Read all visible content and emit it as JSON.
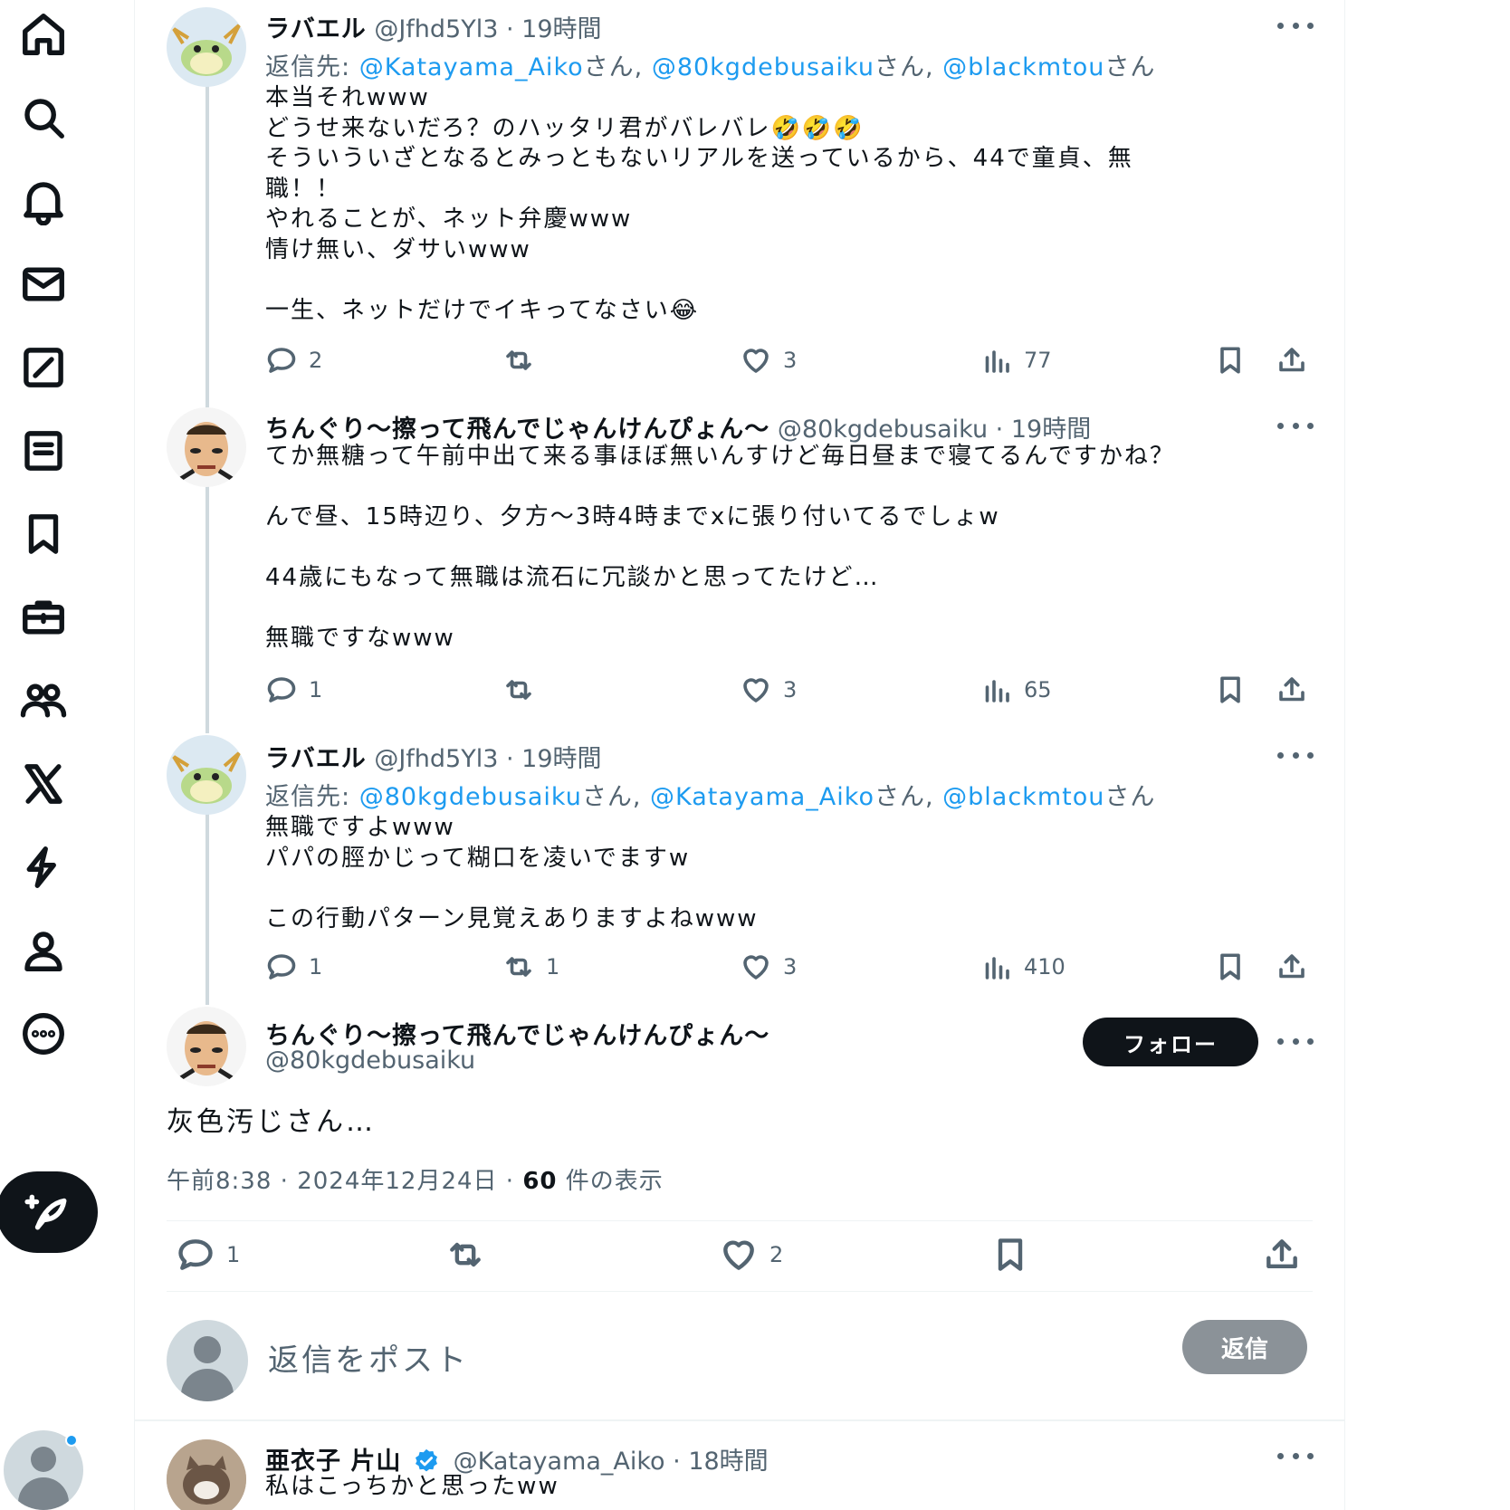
{
  "nav": {
    "icons": [
      "home-icon",
      "search-icon",
      "bell-icon",
      "mail-icon",
      "grok-icon",
      "lists-icon",
      "bookmark-icon",
      "jobs-icon",
      "communities-icon",
      "x-logo-icon",
      "verified-orgs-icon",
      "profile-icon",
      "more-icon"
    ]
  },
  "posts": [
    {
      "name": "ラバエル",
      "handle": "@Jfhd5Yl3",
      "time": "19時間",
      "reply_label": "返信先: ",
      "mentions": [
        "@Katayama_Aiko",
        "@80kgdebusaiku",
        "@blackmtou"
      ],
      "san": "さん",
      "comma": ", ",
      "body": "本当それwww\nどうせ来ないだろ？のハッタリ君がバレバレ🤣🤣🤣\nそういういざとなるとみっともないリアルを送っているから、44で童貞、無\n職！！\nやれることが、ネット弁慶www\n情け無い、ダサいwww\n\n一生、ネットだけでイキってなさい😂",
      "replies": "2",
      "reposts": "",
      "likes": "3",
      "views": "77"
    },
    {
      "name": "ちんぐり〜擦って飛んでじゃんけんぴょん〜",
      "handle": "@80kgdebusaiku",
      "time": "19時間",
      "body": "てか無糖って午前中出て来る事ほぼ無いんすけど毎日昼まで寝てるんですかね？\n\nんで昼、15時辺り、夕方〜3時4時までxに張り付いてるでしょw\n\n44歳にもなって無職は流石に冗談かと思ってたけど…\n\n無職ですなwww",
      "replies": "1",
      "reposts": "",
      "likes": "3",
      "views": "65"
    },
    {
      "name": "ラバエル",
      "handle": "@Jfhd5Yl3",
      "time": "19時間",
      "reply_label": "返信先: ",
      "mentions": [
        "@80kgdebusaiku",
        "@Katayama_Aiko",
        "@blackmtou"
      ],
      "san": "さん",
      "comma": ", ",
      "body": "無職ですよwww\nパパの脛かじって糊口を凌いでますw\n\nこの行動パターン見覚えありますよねwww",
      "replies": "1",
      "reposts": "1",
      "likes": "3",
      "views": "410"
    }
  ],
  "main_post": {
    "name": "ちんぐり〜擦って飛んでじゃんけんぴょん〜",
    "handle": "@80kgdebusaiku",
    "follow_label": "フォロー",
    "text": "灰色汚じさん…",
    "time": "午前8:38",
    "date": "2024年12月24日",
    "views": "60",
    "views_label": "件の表示",
    "dot": "·",
    "replies": "1",
    "likes": "2"
  },
  "reply_box": {
    "placeholder": "返信をポスト",
    "button": "返信"
  },
  "next_post": {
    "name": "亜衣子 片山",
    "handle": "@Katayama_Aiko",
    "time": "18時間",
    "body": "私はこっちかと思ったww"
  },
  "colors": {
    "accent": "#1d9bf0",
    "text": "#0f1419",
    "secondary": "#536471",
    "thread_line": "#cfd9de"
  }
}
